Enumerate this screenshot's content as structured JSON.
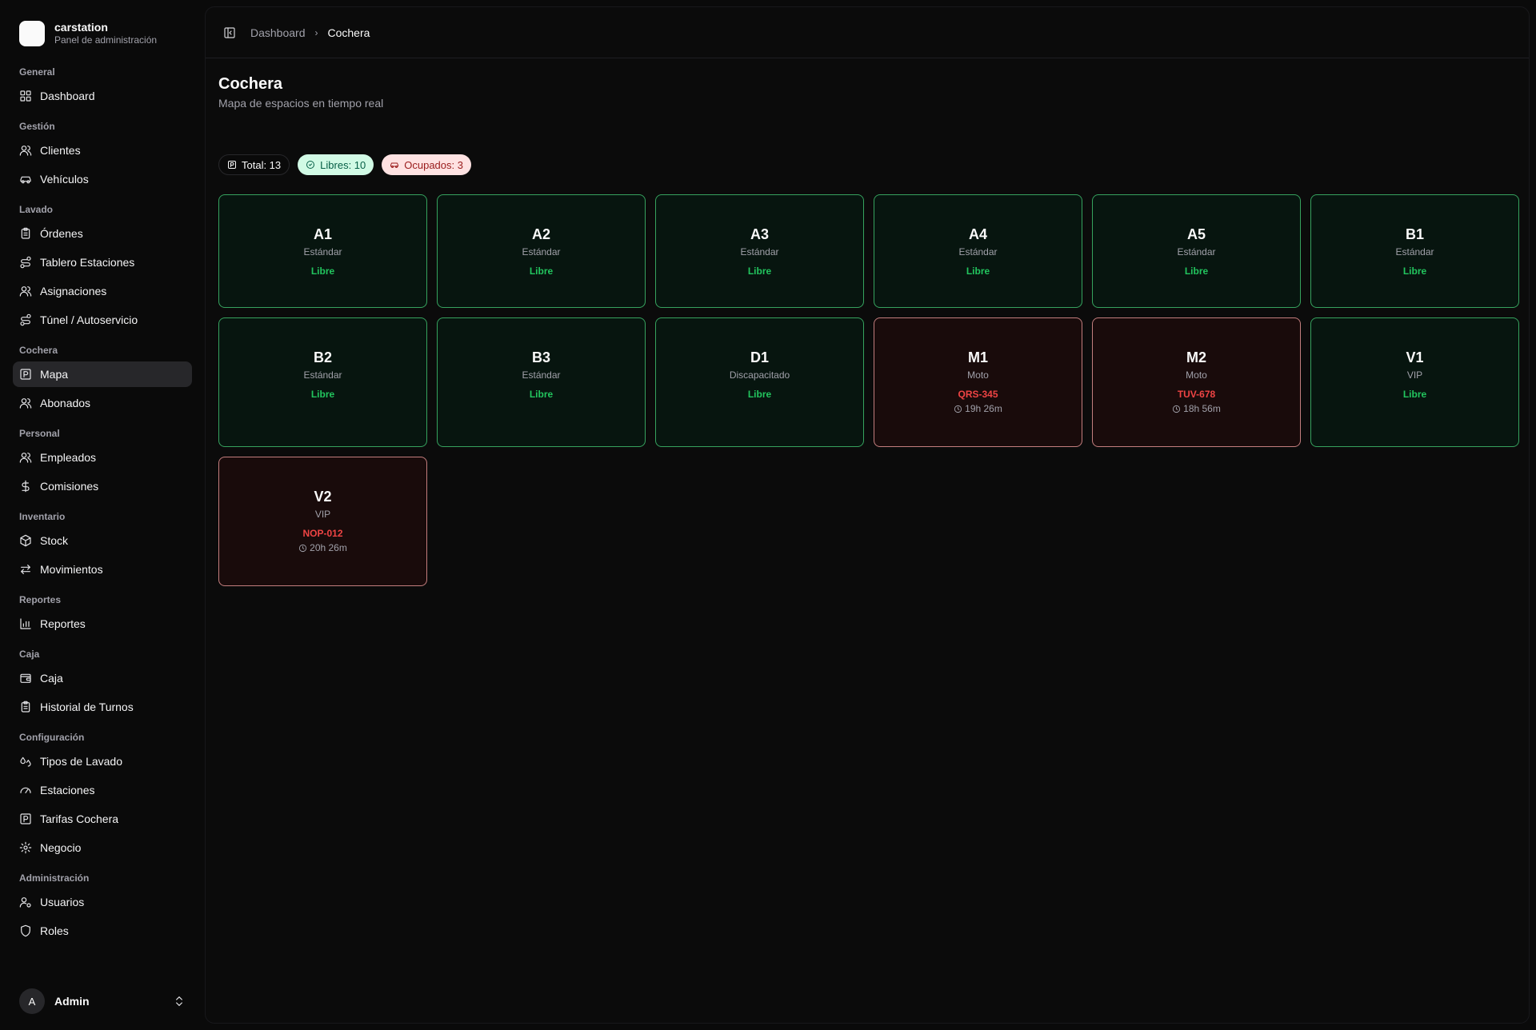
{
  "brand": {
    "name": "carstation",
    "subtitle": "Panel de administración"
  },
  "nav": {
    "general": {
      "label": "General",
      "items": {
        "dashboard": "Dashboard"
      }
    },
    "gestion": {
      "label": "Gestión",
      "items": {
        "clientes": "Clientes",
        "vehiculos": "Vehículos"
      }
    },
    "lavado": {
      "label": "Lavado",
      "items": {
        "ordenes": "Órdenes",
        "tablero": "Tablero Estaciones",
        "asignaciones": "Asignaciones",
        "tunel": "Túnel / Autoservicio"
      }
    },
    "cochera": {
      "label": "Cochera",
      "items": {
        "mapa": "Mapa",
        "abonados": "Abonados"
      }
    },
    "personal": {
      "label": "Personal",
      "items": {
        "empleados": "Empleados",
        "comisiones": "Comisiones"
      }
    },
    "inventario": {
      "label": "Inventario",
      "items": {
        "stock": "Stock",
        "movimientos": "Movimientos"
      }
    },
    "reportes": {
      "label": "Reportes",
      "items": {
        "reportes": "Reportes"
      }
    },
    "caja": {
      "label": "Caja",
      "items": {
        "caja": "Caja",
        "historial": "Historial de Turnos"
      }
    },
    "configuracion": {
      "label": "Configuración",
      "items": {
        "tipos": "Tipos de Lavado",
        "estaciones": "Estaciones",
        "tarifas": "Tarifas Cochera",
        "negocio": "Negocio"
      }
    },
    "administracion": {
      "label": "Administración",
      "items": {
        "usuarios": "Usuarios",
        "roles": "Roles"
      }
    }
  },
  "user": {
    "initial": "A",
    "name": "Admin"
  },
  "breadcrumb": {
    "parent": "Dashboard",
    "current": "Cochera"
  },
  "page": {
    "title": "Cochera",
    "subtitle": "Mapa de espacios en tiempo real"
  },
  "stats": {
    "total": "Total: 13",
    "free": "Libres: 10",
    "occupied": "Ocupados: 3"
  },
  "spots": [
    {
      "code": "A1",
      "type": "Estándar",
      "status": "Libre"
    },
    {
      "code": "A2",
      "type": "Estándar",
      "status": "Libre"
    },
    {
      "code": "A3",
      "type": "Estándar",
      "status": "Libre"
    },
    {
      "code": "A4",
      "type": "Estándar",
      "status": "Libre"
    },
    {
      "code": "A5",
      "type": "Estándar",
      "status": "Libre"
    },
    {
      "code": "B1",
      "type": "Estándar",
      "status": "Libre"
    },
    {
      "code": "B2",
      "type": "Estándar",
      "status": "Libre"
    },
    {
      "code": "B3",
      "type": "Estándar",
      "status": "Libre"
    },
    {
      "code": "D1",
      "type": "Discapacitado",
      "status": "Libre"
    },
    {
      "code": "M1",
      "type": "Moto",
      "status": "QRS-345",
      "time": "19h 26m"
    },
    {
      "code": "M2",
      "type": "Moto",
      "status": "TUV-678",
      "time": "18h 56m"
    },
    {
      "code": "V1",
      "type": "VIP",
      "status": "Libre"
    },
    {
      "code": "V2",
      "type": "VIP",
      "status": "NOP-012",
      "time": "20h 26m"
    }
  ],
  "colors": {
    "free_border": "#4ade80",
    "free_text": "#22c55e",
    "occupied_border": "#fca5a5",
    "occupied_text": "#ef4444"
  }
}
